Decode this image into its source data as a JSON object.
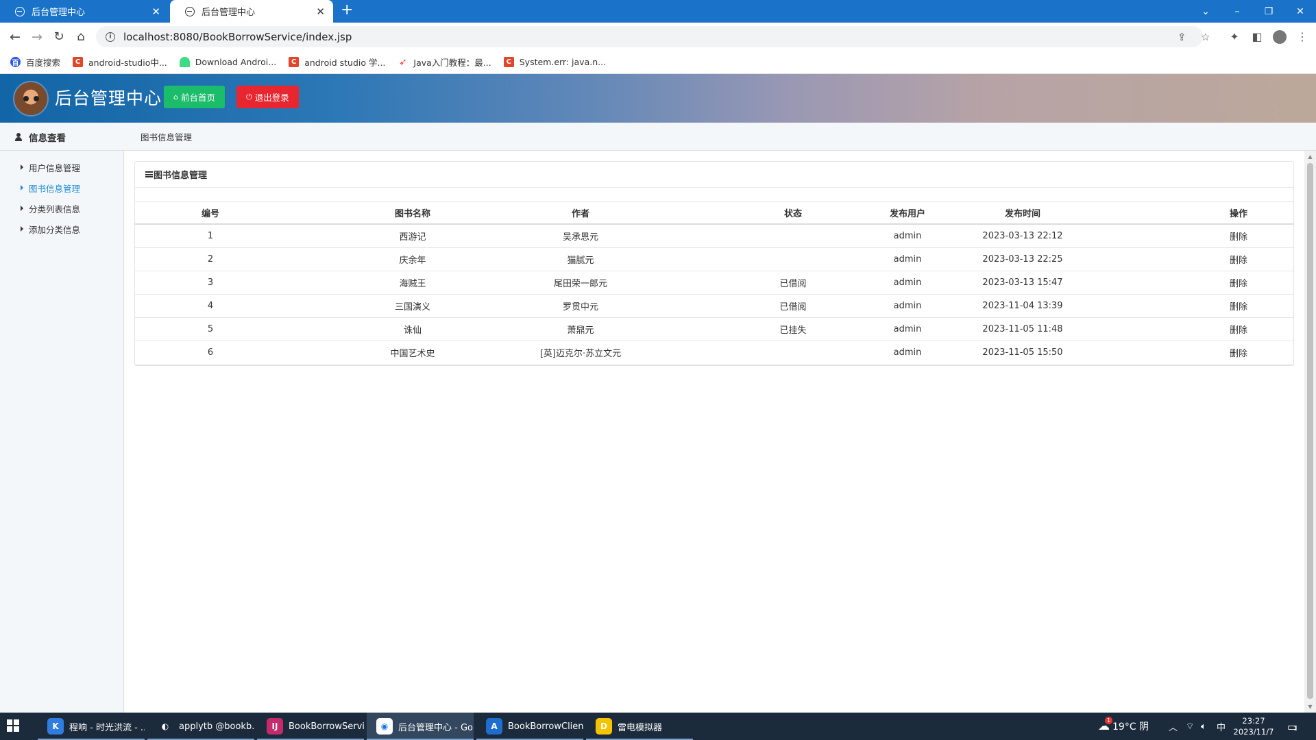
{
  "browser": {
    "tabs": [
      {
        "title": "后台管理中心",
        "active": false
      },
      {
        "title": "后台管理中心",
        "active": true
      }
    ],
    "new_tab": "+",
    "window_controls": {
      "minimize": "–",
      "restore": "❐",
      "close": "✕",
      "tab_search": "⌄"
    },
    "url": "localhost:8080/BookBorrowService/index.jsp",
    "bookmarks": [
      {
        "label": "百度搜索",
        "icon": "baidu-icon",
        "color": "#2d5be3"
      },
      {
        "label": "android-studio中...",
        "icon": "csdn-icon",
        "color": "#e1462b"
      },
      {
        "label": "Download Androi...",
        "icon": "android-icon",
        "color": "#3ddc84"
      },
      {
        "label": "android studio 学...",
        "icon": "csdn-icon",
        "color": "#e1462b"
      },
      {
        "label": "Java入门教程：最...",
        "icon": "swift-icon",
        "color": "#e63a2c"
      },
      {
        "label": "System.err: java.n...",
        "icon": "csdn-icon",
        "color": "#e1462b"
      }
    ]
  },
  "header": {
    "title": "后台管理中心",
    "home_button": "前台首页",
    "logout_button": "退出登录",
    "colors": {
      "home": "#1bbc6a",
      "logout": "#e8262f"
    }
  },
  "sidebar": {
    "heading": "信息查看",
    "items": [
      {
        "label": "用户信息管理",
        "active": false
      },
      {
        "label": "图书信息管理",
        "active": true
      },
      {
        "label": "分类列表信息",
        "active": false
      },
      {
        "label": "添加分类信息",
        "active": false
      }
    ]
  },
  "breadcrumb": "图书信息管理",
  "panel": {
    "title": "图书信息管理",
    "columns": [
      "编号",
      "图书名称",
      "作者",
      "状态",
      "发布用户",
      "发布时间",
      "操作"
    ],
    "rows": [
      [
        "1",
        "西游记",
        "吴承恩元",
        "",
        "admin",
        "2023-03-13 22:12",
        "删除"
      ],
      [
        "2",
        "庆余年",
        "猫腻元",
        "",
        "admin",
        "2023-03-13 22:25",
        "删除"
      ],
      [
        "3",
        "海贼王",
        "尾田荣一郎元",
        "已借阅",
        "admin",
        "2023-03-13 15:47",
        "删除"
      ],
      [
        "4",
        "三国演义",
        "罗贯中元",
        "已借阅",
        "admin",
        "2023-11-04 13:39",
        "删除"
      ],
      [
        "5",
        "诛仙",
        "萧鼎元",
        "已挂失",
        "admin",
        "2023-11-05 11:48",
        "删除"
      ],
      [
        "6",
        "中国艺术史",
        "[英]迈克尔·苏立文元",
        "",
        "admin",
        "2023-11-05 15:50",
        "删除"
      ]
    ]
  },
  "taskbar": {
    "items": [
      {
        "label": "程响 - 时光洪流 - ...",
        "icon_color": "#2f7de1",
        "icon_letter": "K"
      },
      {
        "label": "applytb @bookb...",
        "icon_color": "#1c2b3c",
        "icon_letter": "◐"
      },
      {
        "label": "BookBorrowServi...",
        "icon_color": "#c52a6b",
        "icon_letter": "IJ"
      },
      {
        "label": "后台管理中心 - Go...",
        "icon_color": "#ffffff",
        "icon_letter": "◉"
      },
      {
        "label": "BookBorrowClien...",
        "icon_color": "#1e6ecf",
        "icon_letter": "A"
      },
      {
        "label": "雷电模拟器",
        "icon_color": "#f5c400",
        "icon_letter": "D"
      }
    ],
    "weather": "19°C 阴",
    "weather_badge": "1",
    "ime": "中",
    "time": "23:27",
    "date": "2023/11/7",
    "notification_count": "1"
  }
}
